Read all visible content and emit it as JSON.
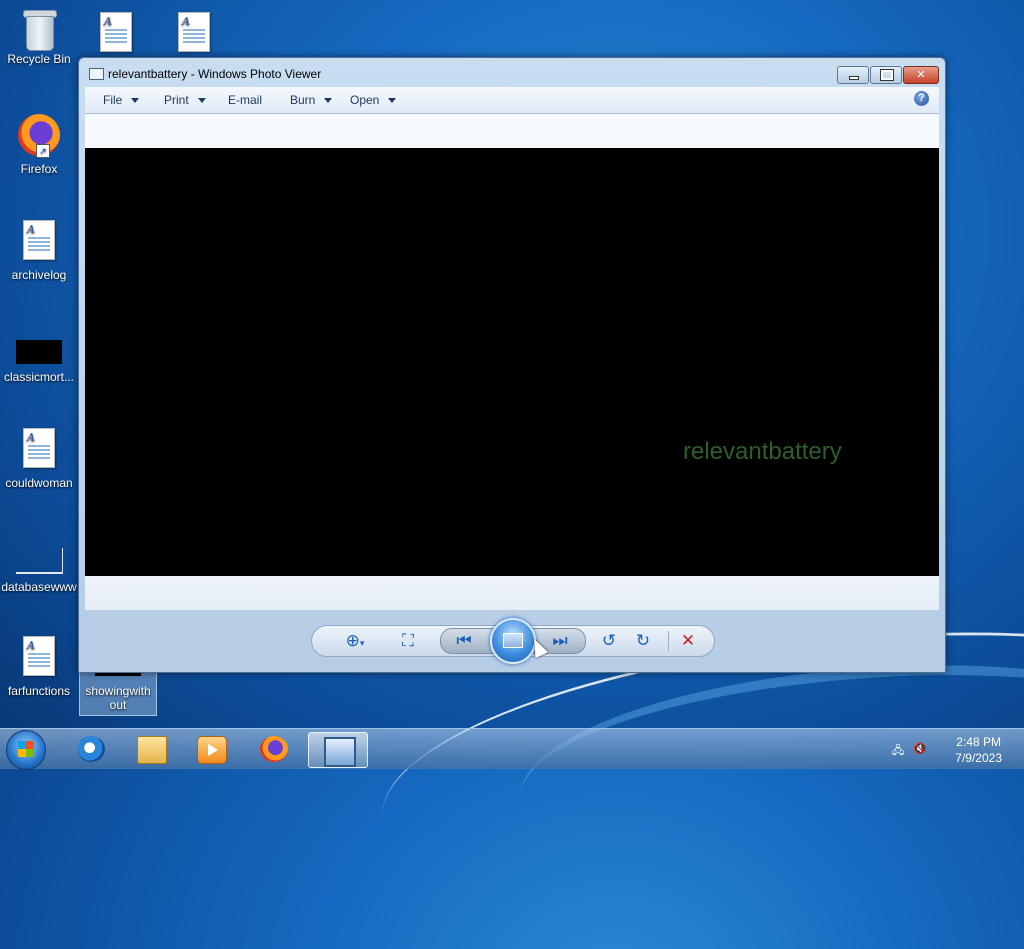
{
  "desktop": {
    "icons": [
      {
        "label": "Recycle Bin",
        "icon": "recycle-bin-icon"
      },
      {
        "label": "",
        "icon": "document-icon"
      },
      {
        "label": "",
        "icon": "document-icon"
      },
      {
        "label": "Firefox",
        "icon": "firefox-icon"
      },
      {
        "label": "archivelog",
        "icon": "document-icon"
      },
      {
        "label": "classicmort...",
        "icon": "image-file-icon"
      },
      {
        "label": "couldwoman",
        "icon": "document-icon"
      },
      {
        "label": "databasewww",
        "icon": "image-file-icon"
      },
      {
        "label": "farfunctions",
        "icon": "document-icon"
      },
      {
        "label": "showingwith out",
        "icon": "image-file-icon"
      }
    ]
  },
  "window": {
    "title": "relevantbattery - Windows Photo Viewer",
    "menu": [
      {
        "label": "File",
        "has_dropdown": true
      },
      {
        "label": "Print",
        "has_dropdown": true
      },
      {
        "label": "E-mail",
        "has_dropdown": false
      },
      {
        "label": "Burn",
        "has_dropdown": true
      },
      {
        "label": "Open",
        "has_dropdown": true
      }
    ],
    "help_glyph": "?",
    "image_text": "relevantbattery",
    "controls": [
      "zoom-icon",
      "actual-size-icon",
      "previous-icon",
      "slideshow-icon",
      "next-icon",
      "rotate-left-icon",
      "rotate-right-icon",
      "delete-icon"
    ]
  },
  "taskbar": {
    "apps": [
      "internet-explorer-icon",
      "file-explorer-icon",
      "media-player-icon",
      "firefox-icon",
      "photo-viewer-icon"
    ],
    "clock": {
      "time": "2:48 PM",
      "date": "7/9/2023"
    }
  },
  "colors": {
    "image_text": "#2e5e2e",
    "accent": "#1d5fb8",
    "close_button": "#c8412a"
  }
}
